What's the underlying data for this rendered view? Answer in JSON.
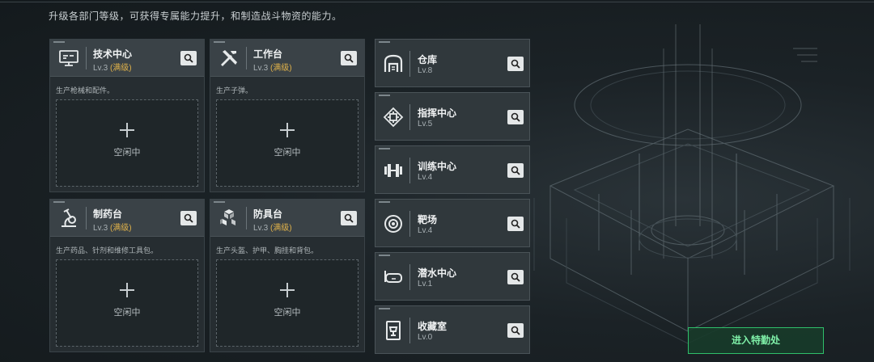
{
  "subtitle": "升级各部门等级，可获得专属能力提升，和制造战斗物资的能力。",
  "workshops": [
    {
      "name": "技术中心",
      "level": "Lv.3",
      "max_tag": "(满级)",
      "desc": "生产枪械和配件。",
      "slot_status": "空闲中",
      "icon": "computer-icon"
    },
    {
      "name": "工作台",
      "level": "Lv.3",
      "max_tag": "(满级)",
      "desc": "生产子弹。",
      "slot_status": "空闲中",
      "icon": "tools-icon"
    },
    {
      "name": "制药台",
      "level": "Lv.3",
      "max_tag": "(满级)",
      "desc": "生产药品、针剂和维修工具包。",
      "slot_status": "空闲中",
      "icon": "microscope-icon"
    },
    {
      "name": "防具台",
      "level": "Lv.3",
      "max_tag": "(满级)",
      "desc": "生产头盔、护甲、胸挂和背包。",
      "slot_status": "空闲中",
      "icon": "cubes-icon"
    }
  ],
  "facilities": [
    {
      "name": "仓库",
      "level": "Lv.8",
      "icon": "warehouse-icon"
    },
    {
      "name": "指挥中心",
      "level": "Lv.5",
      "icon": "chip-icon"
    },
    {
      "name": "训练中心",
      "level": "Lv.4",
      "icon": "dumbbell-icon"
    },
    {
      "name": "靶场",
      "level": "Lv.4",
      "icon": "target-icon"
    },
    {
      "name": "潜水中心",
      "level": "Lv.1",
      "icon": "diving-mask-icon"
    },
    {
      "name": "收藏室",
      "level": "Lv.0",
      "icon": "trophy-case-icon"
    }
  ],
  "enter_button": "进入特勤处",
  "colors": {
    "max_level": "#e0b24a",
    "accent_green": "#2fbf6a"
  }
}
